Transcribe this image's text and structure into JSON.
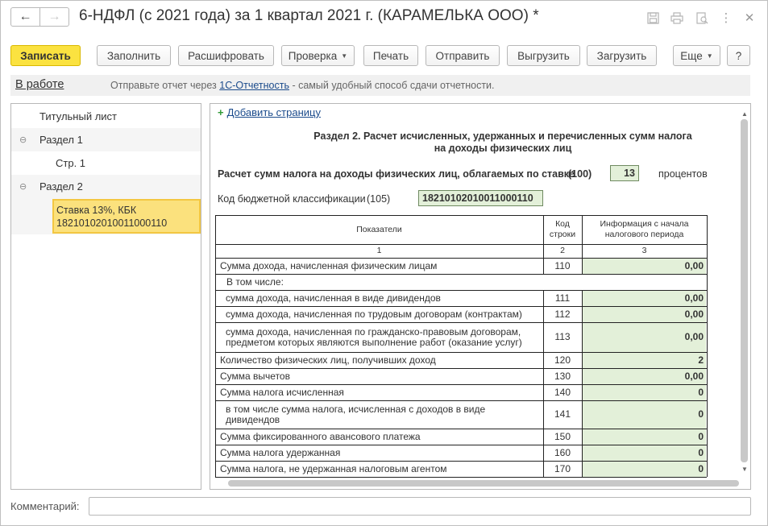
{
  "window": {
    "title": "6-НДФЛ (с 2021 года) за 1 квартал 2021 г. (КАРАМЕЛЬКА ООО) *",
    "back_glyph": "←",
    "forward_glyph": "→",
    "title_icons": [
      "save-icon",
      "print-icon",
      "preview-icon",
      "more-icon",
      "close-icon"
    ],
    "more_glyph": "⋮",
    "close_glyph": "✕"
  },
  "toolbar": {
    "save": "Записать",
    "fill": "Заполнить",
    "decode": "Расшифровать",
    "check": "Проверка",
    "print": "Печать",
    "send": "Отправить",
    "upload": "Выгрузить",
    "load": "Загрузить",
    "more": "Еще",
    "help": "?",
    "caret": "▼"
  },
  "info": {
    "status": "В работе",
    "text_before": "Отправьте отчет через ",
    "link": "1С-Отчетность",
    "text_after": " - самый удобный способ сдачи отчетности."
  },
  "tree": {
    "items": [
      {
        "label": "Титульный лист"
      },
      {
        "label": "Раздел 1",
        "toggle": "⊖"
      },
      {
        "label": "Стр. 1"
      },
      {
        "label": "Раздел 2",
        "toggle": "⊖"
      }
    ],
    "selected_line1": "Ставка 13%, КБК",
    "selected_line2": "18210102010011000110"
  },
  "form": {
    "add_page_plus": "+",
    "add_page": "Добавить страницу",
    "heading_line1": "Раздел 2. Расчет исчисленных, удержанных и перечисленных сумм налога",
    "heading_line2": "на доходы физических лиц",
    "rate_label": "Расчет сумм налога на доходы физических лиц, облагаемых по ставке",
    "rate_code": "(100)",
    "rate_value": "13",
    "rate_unit": "процентов",
    "kbk_label": "Код бюджетной классификации",
    "kbk_code": "(105)",
    "kbk_value": "18210102010011000110",
    "scroll_up": "▲",
    "scroll_down": "▼"
  },
  "table": {
    "headers": {
      "indicator": "Показатели",
      "code": "Код строки",
      "info": "Информация с начала налогового периода"
    },
    "col_numbers": [
      "1",
      "2",
      "3"
    ],
    "subheader": "В том числе:",
    "rows": [
      {
        "label": "Сумма дохода, начисленная физическим лицам",
        "code": "110",
        "value": "0,00"
      },
      {
        "label": "сумма дохода, начисленная в виде дивидендов",
        "code": "111",
        "value": "0,00"
      },
      {
        "label": "сумма дохода, начисленная по трудовым договорам (контрактам)",
        "code": "112",
        "value": "0,00"
      },
      {
        "label": "сумма дохода, начисленная по гражданско-правовым договорам, предметом которых являются выполнение работ (оказание услуг)",
        "code": "113",
        "value": "0,00"
      },
      {
        "label": "Количество физических лиц, получивших доход",
        "code": "120",
        "value": "2"
      },
      {
        "label": "Сумма вычетов",
        "code": "130",
        "value": "0,00"
      },
      {
        "label": "Сумма налога исчисленная",
        "code": "140",
        "value": "0"
      },
      {
        "label": "в том числе сумма налога, исчисленная с доходов в виде дивидендов",
        "code": "141",
        "value": "0"
      },
      {
        "label": "Сумма фиксированного авансового платежа",
        "code": "150",
        "value": "0"
      },
      {
        "label": "Сумма налога удержанная",
        "code": "160",
        "value": "0"
      },
      {
        "label": "Сумма налога, не удержанная налоговым агентом",
        "code": "170",
        "value": "0"
      }
    ]
  },
  "comment": {
    "label": "Комментарий:",
    "value": ""
  }
}
